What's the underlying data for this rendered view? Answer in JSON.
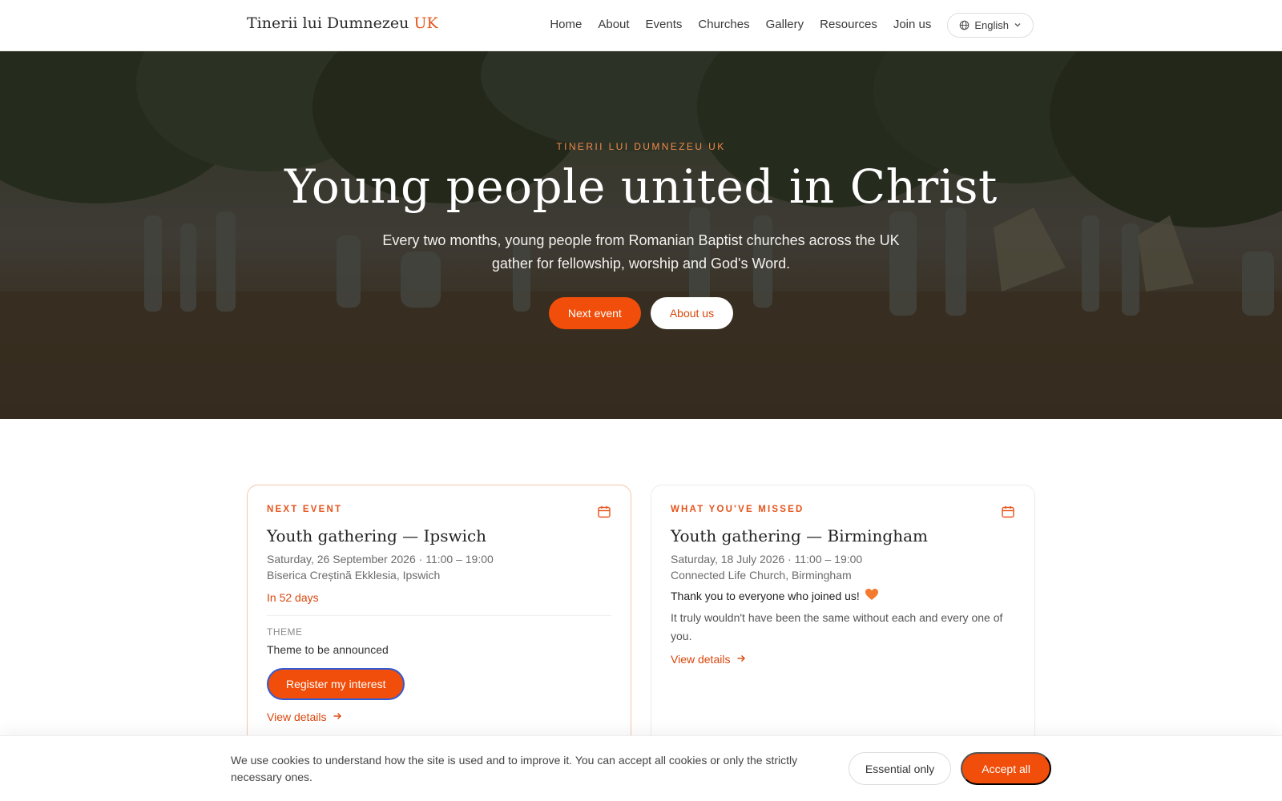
{
  "header": {
    "brand_main": "Tinerii lui Dumnezeu",
    "brand_accent": "UK",
    "nav": [
      "Home",
      "About",
      "Events",
      "Churches",
      "Gallery",
      "Resources",
      "Join us"
    ],
    "language": "English"
  },
  "hero": {
    "eyebrow": "TINERII LUI DUMNEZEU UK",
    "title": "Young people united in Christ",
    "subtitle": "Every two months, young people from Romanian Baptist churches across the UK gather for fellowship, worship and God's Word.",
    "primary_button": "Next event",
    "secondary_button": "About us"
  },
  "next_event": {
    "eyebrow": "NEXT EVENT",
    "title": "Youth gathering — Ipswich",
    "date_time": "Saturday, 26 September 2026 · 11:00 – 19:00",
    "venue": "Biserica Creștină Ekklesia, Ipswich",
    "countdown": "In 52 days",
    "theme_label": "THEME",
    "theme_value": "Theme to be announced",
    "register_button": "Register my interest",
    "details_link": "View details"
  },
  "missed_event": {
    "eyebrow": "WHAT YOU'VE MISSED",
    "title": "Youth gathering — Birmingham",
    "date_time": "Saturday, 18 July 2026 · 11:00 – 19:00",
    "venue": "Connected Life Church, Birmingham",
    "thanks": "Thank you to everyone who joined us!",
    "thanks_body": "It truly wouldn't have been the same without each and every one of you.",
    "details_link": "View details"
  },
  "cookie": {
    "text": "We use cookies to understand how the site is used and to improve it. You can accept all cookies or only the strictly necessary ones.",
    "essential_button": "Essential only",
    "accept_button": "Accept all"
  },
  "colors": {
    "accent": "#f04e0a",
    "accent_text": "#d9470c",
    "eyebrow_hero": "#f08a4b"
  },
  "icons": [
    "globe-icon",
    "chevron-down-icon",
    "calendar-icon",
    "arrow-right-icon",
    "heart-icon"
  ]
}
